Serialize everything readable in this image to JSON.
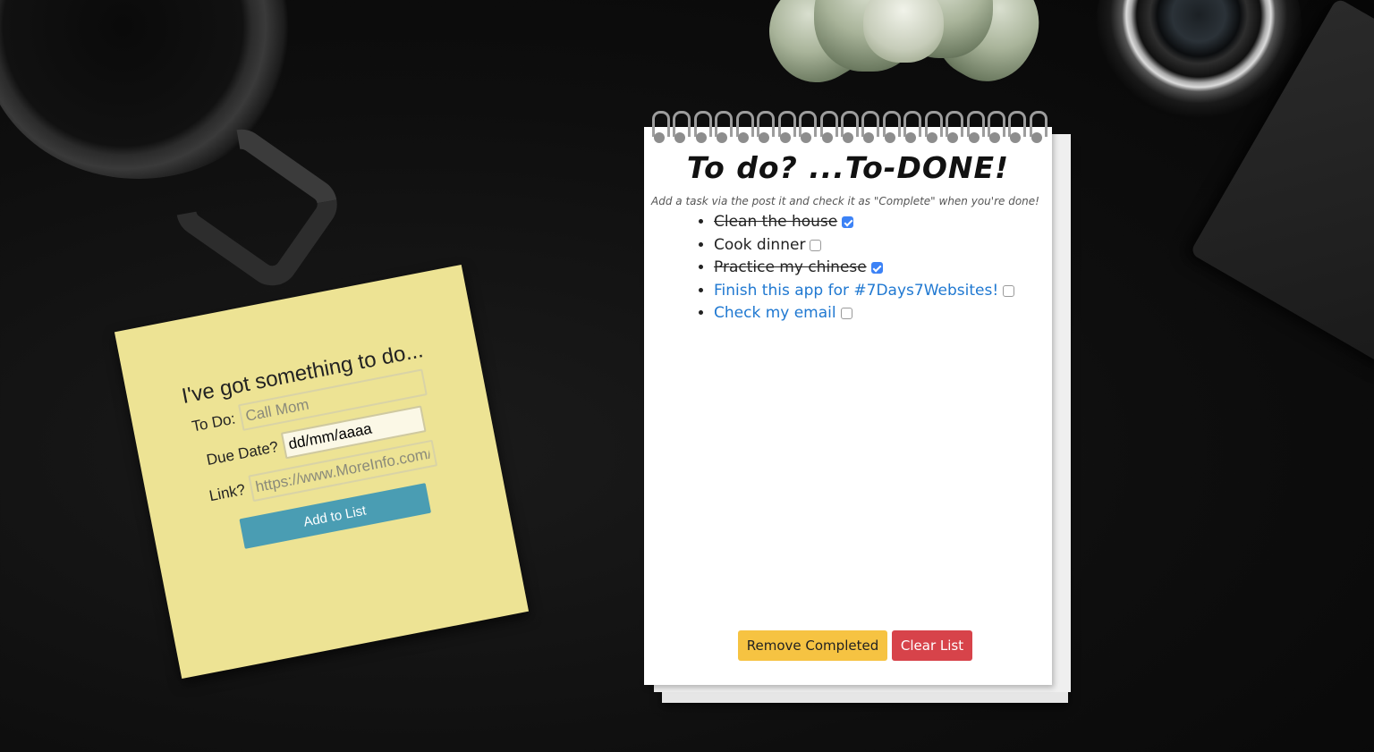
{
  "colors": {
    "sticky_note": "#ede394",
    "add_button": "#4a9db3",
    "remove_button": "#f6c342",
    "clear_button": "#d7434a",
    "link_text": "#1f78d1",
    "checkbox_checked": "#3c82f6"
  },
  "sticky": {
    "heading": "I've got something to do...",
    "todo_label": "To Do:",
    "todo_placeholder": "Call Mom",
    "date_label": "Due Date?",
    "date_value": "dd/mm/aaaa",
    "link_label": "Link?",
    "link_placeholder": "https://www.MoreInfo.com/",
    "add_button": "Add to List"
  },
  "notebook": {
    "title": "To do? ...To-DONE!",
    "subtitle": "Add a task via the post it and check it as \"Complete\" when you're done!",
    "tasks": [
      {
        "text": "Clean the house",
        "completed": true,
        "is_link": false
      },
      {
        "text": "Cook dinner",
        "completed": false,
        "is_link": false
      },
      {
        "text": "Practice my chinese",
        "completed": true,
        "is_link": false
      },
      {
        "text": "Finish this app for #7Days7Websites!",
        "completed": false,
        "is_link": true
      },
      {
        "text": "Check my email",
        "completed": false,
        "is_link": true
      }
    ],
    "remove_button": "Remove Completed",
    "clear_button": "Clear List"
  }
}
